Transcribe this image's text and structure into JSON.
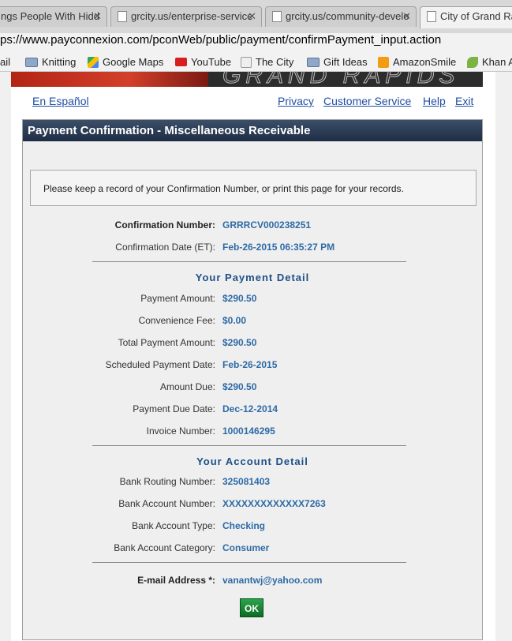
{
  "browser": {
    "tabs": [
      {
        "label": "ngs People With Hidd"
      },
      {
        "label": "grcity.us/enterprise-service"
      },
      {
        "label": "grcity.us/community-develo"
      },
      {
        "label": "City of Grand Rap"
      }
    ],
    "url": "ps://www.payconnexion.com/pconWeb/public/payment/confirmPayment_input.action",
    "bookmarks": [
      {
        "label": "ail"
      },
      {
        "label": "Knitting"
      },
      {
        "label": "Google Maps"
      },
      {
        "label": "YouTube"
      },
      {
        "label": "The City"
      },
      {
        "label": "Gift Ideas"
      },
      {
        "label": "AmazonSmile"
      },
      {
        "label": "Khan A"
      }
    ]
  },
  "header": {
    "language_link": "En Español",
    "links": [
      "Privacy",
      "Customer Service",
      "Help",
      "Exit"
    ]
  },
  "panel": {
    "title": "Payment Confirmation - Miscellaneous Receivable",
    "notice": "Please keep a record of your Confirmation Number, or print this page for your records.",
    "confirmation": [
      {
        "label": "Confirmation Number:",
        "value": "GRRRCV000238251"
      },
      {
        "label": "Confirmation Date (ET):",
        "value": "Feb-26-2015 06:35:27 PM"
      }
    ],
    "payment_title": "Your Payment Detail",
    "payment": [
      {
        "label": "Payment Amount:",
        "value": "$290.50"
      },
      {
        "label": "Convenience Fee:",
        "value": "$0.00"
      },
      {
        "label": "Total Payment Amount:",
        "value": "$290.50"
      },
      {
        "label": "Scheduled Payment Date:",
        "value": "Feb-26-2015"
      },
      {
        "label": "Amount Due:",
        "value": "$290.50"
      },
      {
        "label": "Payment Due Date:",
        "value": "Dec-12-2014"
      },
      {
        "label": "Invoice Number:",
        "value": "1000146295"
      }
    ],
    "account_title": "Your Account Detail",
    "account": [
      {
        "label": "Bank Routing Number:",
        "value": "325081403"
      },
      {
        "label": "Bank Account Number:",
        "value": "XXXXXXXXXXXXX7263"
      },
      {
        "label": "Bank Account Type:",
        "value": "Checking"
      },
      {
        "label": "Bank Account Category:",
        "value": "Consumer"
      }
    ],
    "email": {
      "label": "E-mail Address *:",
      "value": "vanantwj@yahoo.com"
    },
    "ok_label": "OK"
  }
}
